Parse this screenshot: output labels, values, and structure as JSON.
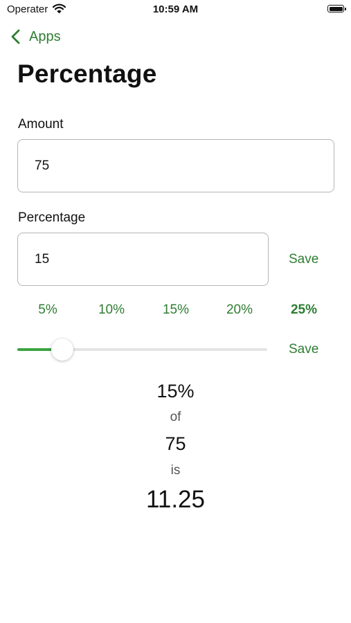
{
  "status_bar": {
    "carrier": "Operater",
    "time": "10:59 AM"
  },
  "nav": {
    "back_label": "Apps",
    "title": "Percentage"
  },
  "amount": {
    "label": "Amount",
    "value": "75"
  },
  "percentage": {
    "label": "Percentage",
    "value": "15",
    "save_label": "Save"
  },
  "presets": [
    {
      "label": "5%",
      "selected": false
    },
    {
      "label": "10%",
      "selected": false
    },
    {
      "label": "15%",
      "selected": false
    },
    {
      "label": "20%",
      "selected": false
    },
    {
      "label": "25%",
      "selected": true
    }
  ],
  "slider": {
    "value": 0.18,
    "save_label": "Save"
  },
  "result": {
    "percent": "15%",
    "of_label": "of",
    "amount": "75",
    "is_label": "is",
    "answer": "11.25"
  },
  "colors": {
    "accent": "#2e7d32",
    "slider_fill": "#3aa342",
    "field_border": "#b5b5b5"
  }
}
